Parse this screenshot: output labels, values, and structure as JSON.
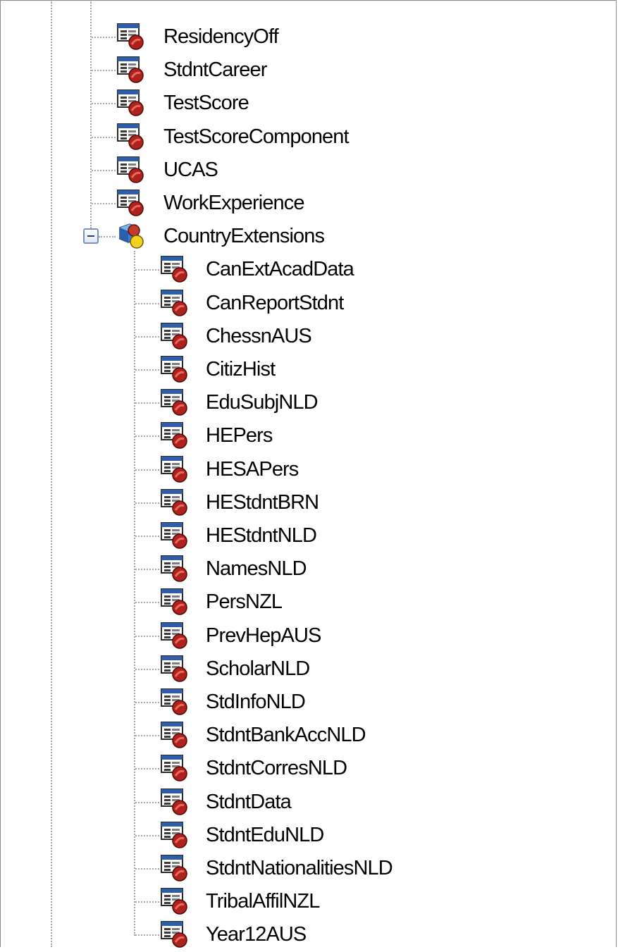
{
  "tree": {
    "upper_items": [
      {
        "label": "ResidencyOff",
        "icon": "record-node-icon"
      },
      {
        "label": "StdntCareer",
        "icon": "record-node-icon"
      },
      {
        "label": "TestScore",
        "icon": "record-node-icon"
      },
      {
        "label": "TestScoreComponent",
        "icon": "record-node-icon"
      },
      {
        "label": "UCAS",
        "icon": "record-node-icon"
      },
      {
        "label": "WorkExperience",
        "icon": "record-node-icon"
      }
    ],
    "group": {
      "label": "CountryExtensions",
      "icon": "group-folder-icon",
      "expanded": true,
      "expander_glyph": "minus"
    },
    "child_items": [
      {
        "label": "CanExtAcadData",
        "icon": "record-node-icon"
      },
      {
        "label": "CanReportStdnt",
        "icon": "record-node-icon"
      },
      {
        "label": "ChessnAUS",
        "icon": "record-node-icon"
      },
      {
        "label": "CitizHist",
        "icon": "record-node-icon"
      },
      {
        "label": "EduSubjNLD",
        "icon": "record-node-icon"
      },
      {
        "label": "HEPers",
        "icon": "record-node-icon"
      },
      {
        "label": "HESAPers",
        "icon": "record-node-icon"
      },
      {
        "label": "HEStdntBRN",
        "icon": "record-node-icon"
      },
      {
        "label": "HEStdntNLD",
        "icon": "record-node-icon"
      },
      {
        "label": "NamesNLD",
        "icon": "record-node-icon"
      },
      {
        "label": "PersNZL",
        "icon": "record-node-icon"
      },
      {
        "label": "PrevHepAUS",
        "icon": "record-node-icon"
      },
      {
        "label": "ScholarNLD",
        "icon": "record-node-icon"
      },
      {
        "label": "StdInfoNLD",
        "icon": "record-node-icon"
      },
      {
        "label": "StdntBankAccNLD",
        "icon": "record-node-icon"
      },
      {
        "label": "StdntCorresNLD",
        "icon": "record-node-icon"
      },
      {
        "label": "StdntData",
        "icon": "record-node-icon"
      },
      {
        "label": "StdntEduNLD",
        "icon": "record-node-icon"
      },
      {
        "label": "StdntNationalitiesNLD",
        "icon": "record-node-icon"
      },
      {
        "label": "TribalAffilNZL",
        "icon": "record-node-icon"
      },
      {
        "label": "Year12AUS",
        "icon": "record-node-icon"
      }
    ]
  },
  "colors": {
    "connector": "#a8a8a8",
    "icon_window_blue": "#2f5ea8",
    "icon_badge_red": "#b0201c",
    "group_badge_yellow": "#f2d21b"
  }
}
